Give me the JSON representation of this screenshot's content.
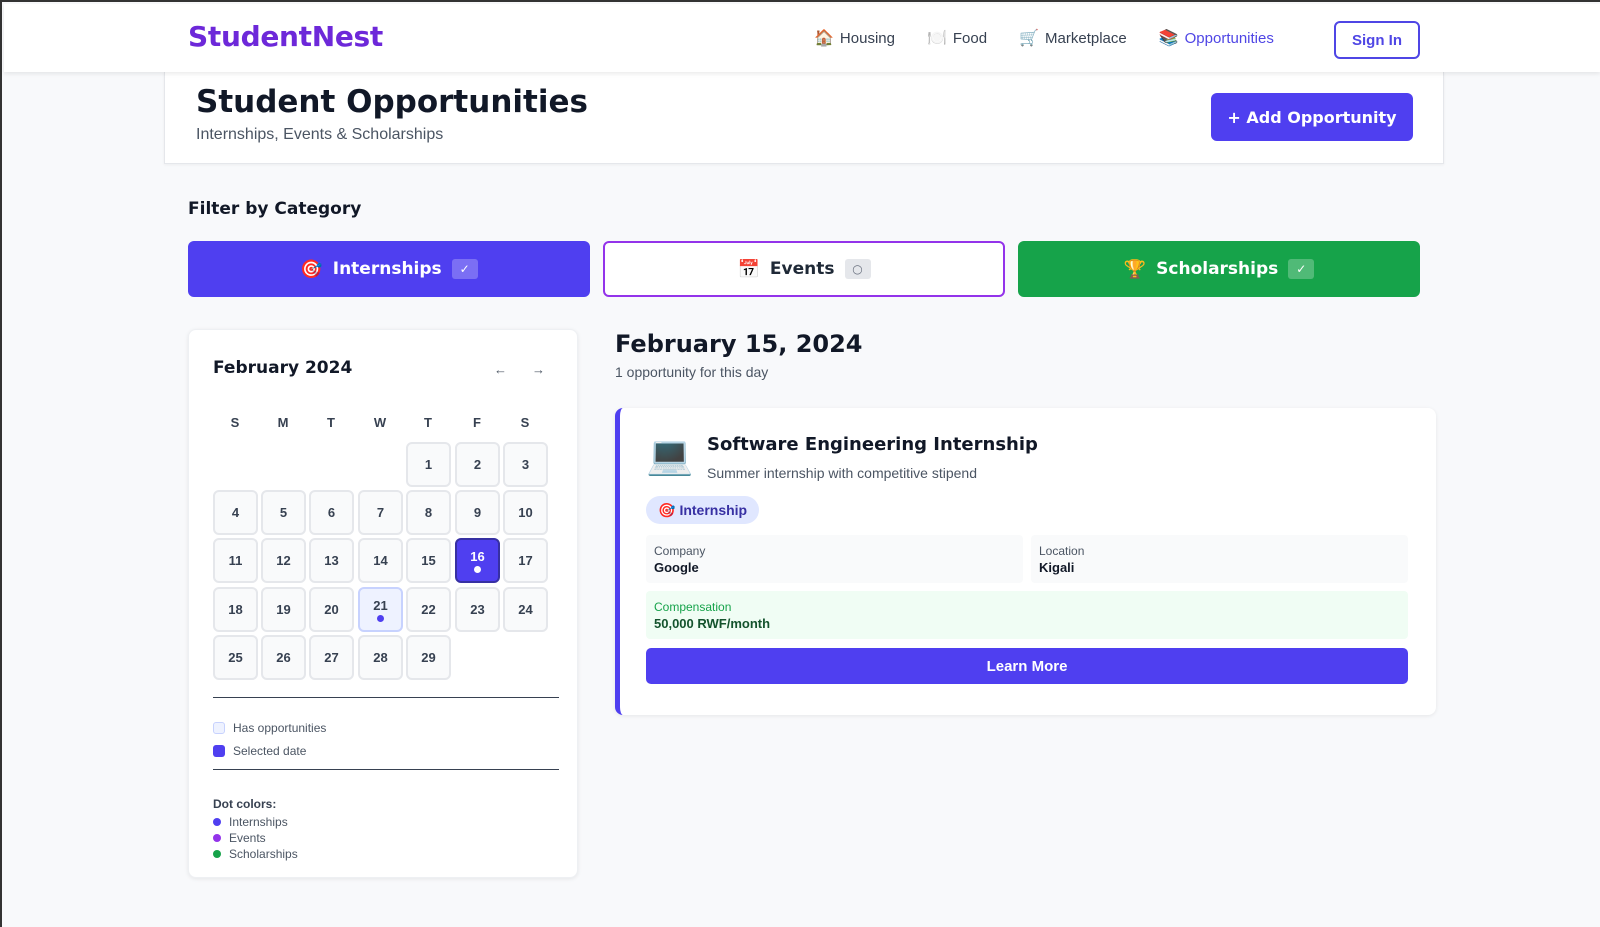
{
  "brand": "StudentNest",
  "nav": [
    {
      "icon": "house-icon",
      "glyph": "🏠",
      "label": "Housing",
      "active": false
    },
    {
      "icon": "plate-icon",
      "glyph": "🍽️",
      "label": "Food",
      "active": false
    },
    {
      "icon": "cart-icon",
      "glyph": "🛒",
      "label": "Marketplace",
      "active": false
    },
    {
      "icon": "books-icon",
      "glyph": "📚",
      "label": "Opportunities",
      "active": true
    }
  ],
  "signin_label": "Sign In",
  "header": {
    "title": "Student Opportunities",
    "subtitle": "Internships, Events & Scholarships",
    "add_label": "+ Add Opportunity"
  },
  "filter": {
    "title": "Filter by Category",
    "categories": [
      {
        "glyph": "🎯",
        "icon": "target-icon",
        "label": "Internships",
        "check": "✓",
        "selected": true,
        "color": "#4f3ff0"
      },
      {
        "glyph": "📅",
        "icon": "calendar-icon",
        "label": "Events",
        "check": "○",
        "selected": false,
        "color": "#9333ea"
      },
      {
        "glyph": "🏆",
        "icon": "trophy-icon",
        "label": "Scholarships",
        "check": "✓",
        "selected": true,
        "color": "#16a34a"
      }
    ]
  },
  "calendar": {
    "month_label": "February 2024",
    "prev": "←",
    "next": "→",
    "weekdays": [
      "S",
      "M",
      "T",
      "W",
      "T",
      "F",
      "S"
    ],
    "first_weekday": 4,
    "days_in_month": 29,
    "selected_day": 16,
    "has_opportunities": [
      16,
      21
    ],
    "legend": {
      "has": "Has opportunities",
      "selected": "Selected date",
      "dot_title": "Dot colors:",
      "dots": [
        {
          "label": "Internships",
          "color": "#4f3ff0"
        },
        {
          "label": "Events",
          "color": "#9333ea"
        },
        {
          "label": "Scholarships",
          "color": "#16a34a"
        }
      ]
    }
  },
  "detail": {
    "date": "February 15, 2024",
    "count": "1 opportunity for this day",
    "opportunity": {
      "glyph": "💻",
      "title": "Software Engineering Internship",
      "description": "Summer internship with competitive stipend",
      "tag_glyph": "🎯",
      "tag": "Internship",
      "company_label": "Company",
      "company": "Google",
      "location_label": "Location",
      "location": "Kigali",
      "compensation_label": "Compensation",
      "compensation": "50,000 RWF/month",
      "cta": "Learn More"
    }
  }
}
